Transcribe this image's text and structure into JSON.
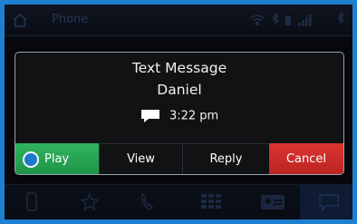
{
  "statusbar": {
    "title": "Phone",
    "home_icon": "home-icon",
    "status_icons": [
      "wifi-icon",
      "bluetooth-icon",
      "battery-icon",
      "signal-icon",
      "bluetooth-icon"
    ]
  },
  "dialog": {
    "title": "Text Message",
    "sender": "Daniel",
    "time": "3:22 pm",
    "bubble_icon": "message-bubble-icon",
    "buttons": {
      "play": "Play",
      "view": "View",
      "reply": "Reply",
      "cancel": "Cancel"
    },
    "colors": {
      "play": "#27a152",
      "cancel": "#cf2d2a",
      "play_circle": "#1d79c9"
    }
  },
  "navbar": {
    "items": [
      "phone-icon",
      "favorites-star-icon",
      "recent-calls-icon",
      "keypad-icon",
      "contacts-icon",
      "messages-icon"
    ]
  },
  "colors": {
    "frame_border": "#1f7fd0"
  }
}
